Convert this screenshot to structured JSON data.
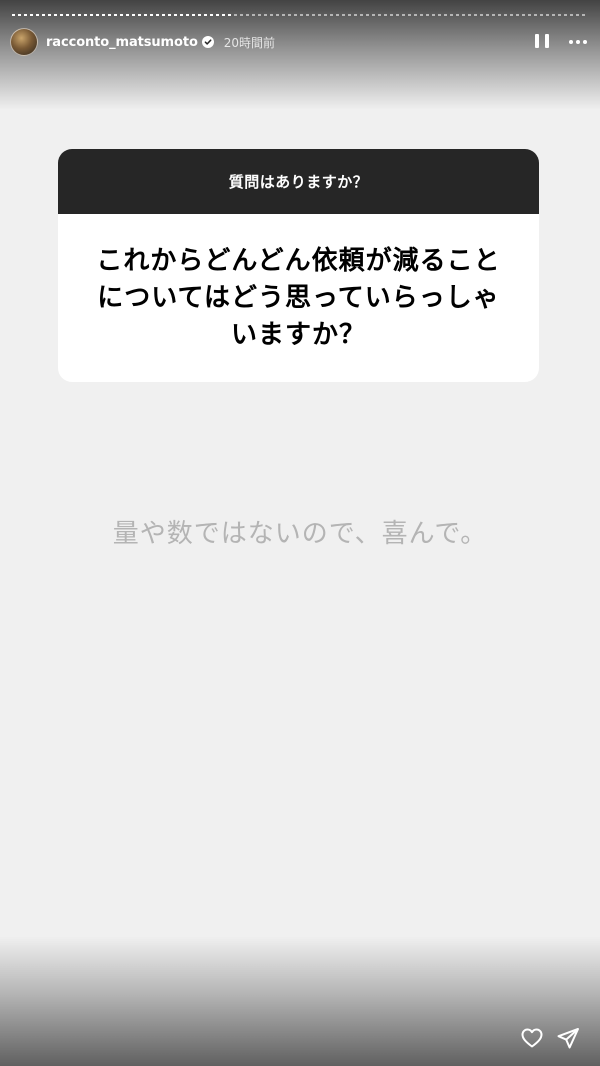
{
  "story": {
    "progress_fraction": 0.38,
    "colors": {
      "background": "#f0f0f0",
      "card_header": "#262626",
      "card_body": "#ffffff",
      "answer_text": "#b4b4b4"
    }
  },
  "header": {
    "username": "racconto_matsumoto",
    "verified_icon": "verified-badge-icon",
    "time_ago": "20時間前",
    "pause_icon": "pause-icon",
    "more_icon": "more-options-icon"
  },
  "question_card": {
    "prompt": "質問はありますか？",
    "question": "これからどんどん依頼が減ることについてはどう思っていらっしゃいますか？"
  },
  "answer": {
    "text": "量や数ではないので、喜んで。"
  },
  "footer": {
    "like_icon": "heart-icon",
    "share_icon": "send-icon"
  }
}
